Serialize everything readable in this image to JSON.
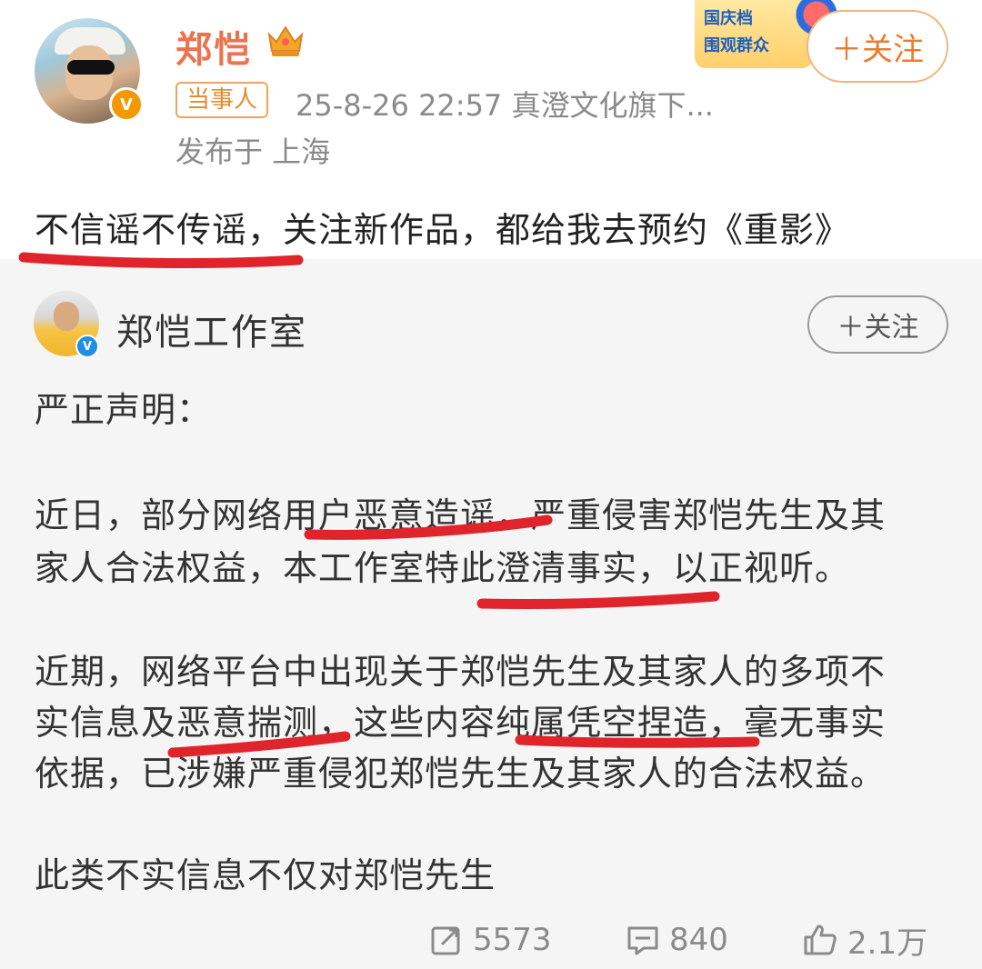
{
  "author": {
    "name": "郑恺",
    "role_tag": "当事人",
    "time_source": "25-8-26 22:57  真澄文化旗下...",
    "location": "发布于 上海",
    "follow_label": "＋关注"
  },
  "promo": {
    "line1": "国庆档",
    "line2": "围观群众"
  },
  "post": {
    "text": "不信谣不传谣，关注新作品，都给我去预约《重影》"
  },
  "repost": {
    "name": "郑恺工作室",
    "follow_label": "＋关注",
    "paragraphs": [
      "严正声明：",
      "近日，部分网络用户恶意造谣，严重侵害郑恺先生及其",
      "家人合法权益，本工作室特此澄清事实，以正视听。",
      "近期，网络平台中出现关于郑恺先生及其家人的多项不",
      "实信息及恶意揣测，这些内容纯属凭空捏造，毫无事实",
      "依据，已涉嫌严重侵犯郑恺先生及其家人的合法权益。",
      "此类不实信息不仅对郑恺先生"
    ]
  },
  "actions": {
    "repost_count": "5573",
    "comment_count": "840",
    "like_count": "2.1万"
  },
  "colors": {
    "accent_orange": "#eb7350",
    "annotation_red": "#e0242c",
    "verified_blue": "#1f8ee6"
  }
}
